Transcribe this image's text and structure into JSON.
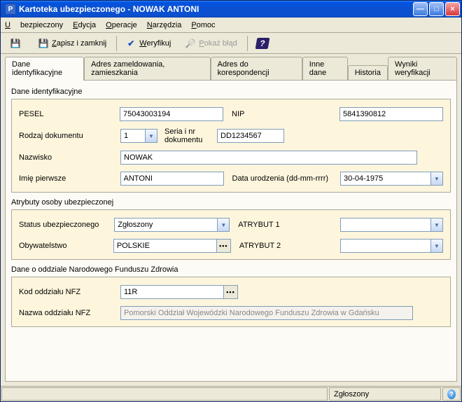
{
  "window": {
    "title": "Kartoteka ubezpieczonego - NOWAK ANTONI"
  },
  "menu": {
    "ubezpieczony": "Ubezpieczony",
    "edycja": "Edycja",
    "operacje": "Operacje",
    "narzedzia": "Narzędzia",
    "pomoc": "Pomoc"
  },
  "toolbar": {
    "zapisz_zamknij": "Zapisz i zamknij",
    "weryfikuj": "Weryfikuj",
    "pokaz_blad": "Pokaż błąd"
  },
  "tabs": {
    "identyfikacyjne": "Dane identyfikacyjne",
    "adres_zamel": "Adres zameldowania, zamieszkania",
    "adres_kor": "Adres do korespondencji",
    "inne": "Inne dane",
    "historia": "Historia",
    "wyniki": "Wyniki weryfikacji"
  },
  "sec1": {
    "title": "Dane identyfikacyjne",
    "pesel_label": "PESEL",
    "pesel": "75043003194",
    "nip_label": "NIP",
    "nip": "5841390812",
    "rodzaj_label": "Rodzaj dokumentu",
    "rodzaj": "1",
    "seria_label": "Seria i nr dokumentu",
    "seria": "DD1234567",
    "nazwisko_label": "Nazwisko",
    "nazwisko": "NOWAK",
    "imie_label": "Imię pierwsze",
    "imie": "ANTONI",
    "data_label": "Data urodzenia (dd-mm-rrrr)",
    "data": "30-04-1975"
  },
  "sec2": {
    "title": "Atrybuty osoby ubezpieczonej",
    "status_label": "Status ubezpieczonego",
    "status": "Zgłoszony",
    "a1_label": "ATRYBUT 1",
    "a1": "",
    "obyw_label": "Obywatelstwo",
    "obyw": "POLSKIE",
    "a2_label": "ATRYBUT 2",
    "a2": ""
  },
  "sec3": {
    "title": "Dane o oddziale Narodowego Funduszu Zdrowia",
    "kod_label": "Kod oddziału NFZ",
    "kod": "11R",
    "nazwa_label": "Nazwa oddziału NFZ",
    "nazwa": "Pomorski Oddział Wojewódzki Narodowego Funduszu Zdrowia w Gdańsku"
  },
  "status": {
    "mid": "Zgłoszony"
  }
}
